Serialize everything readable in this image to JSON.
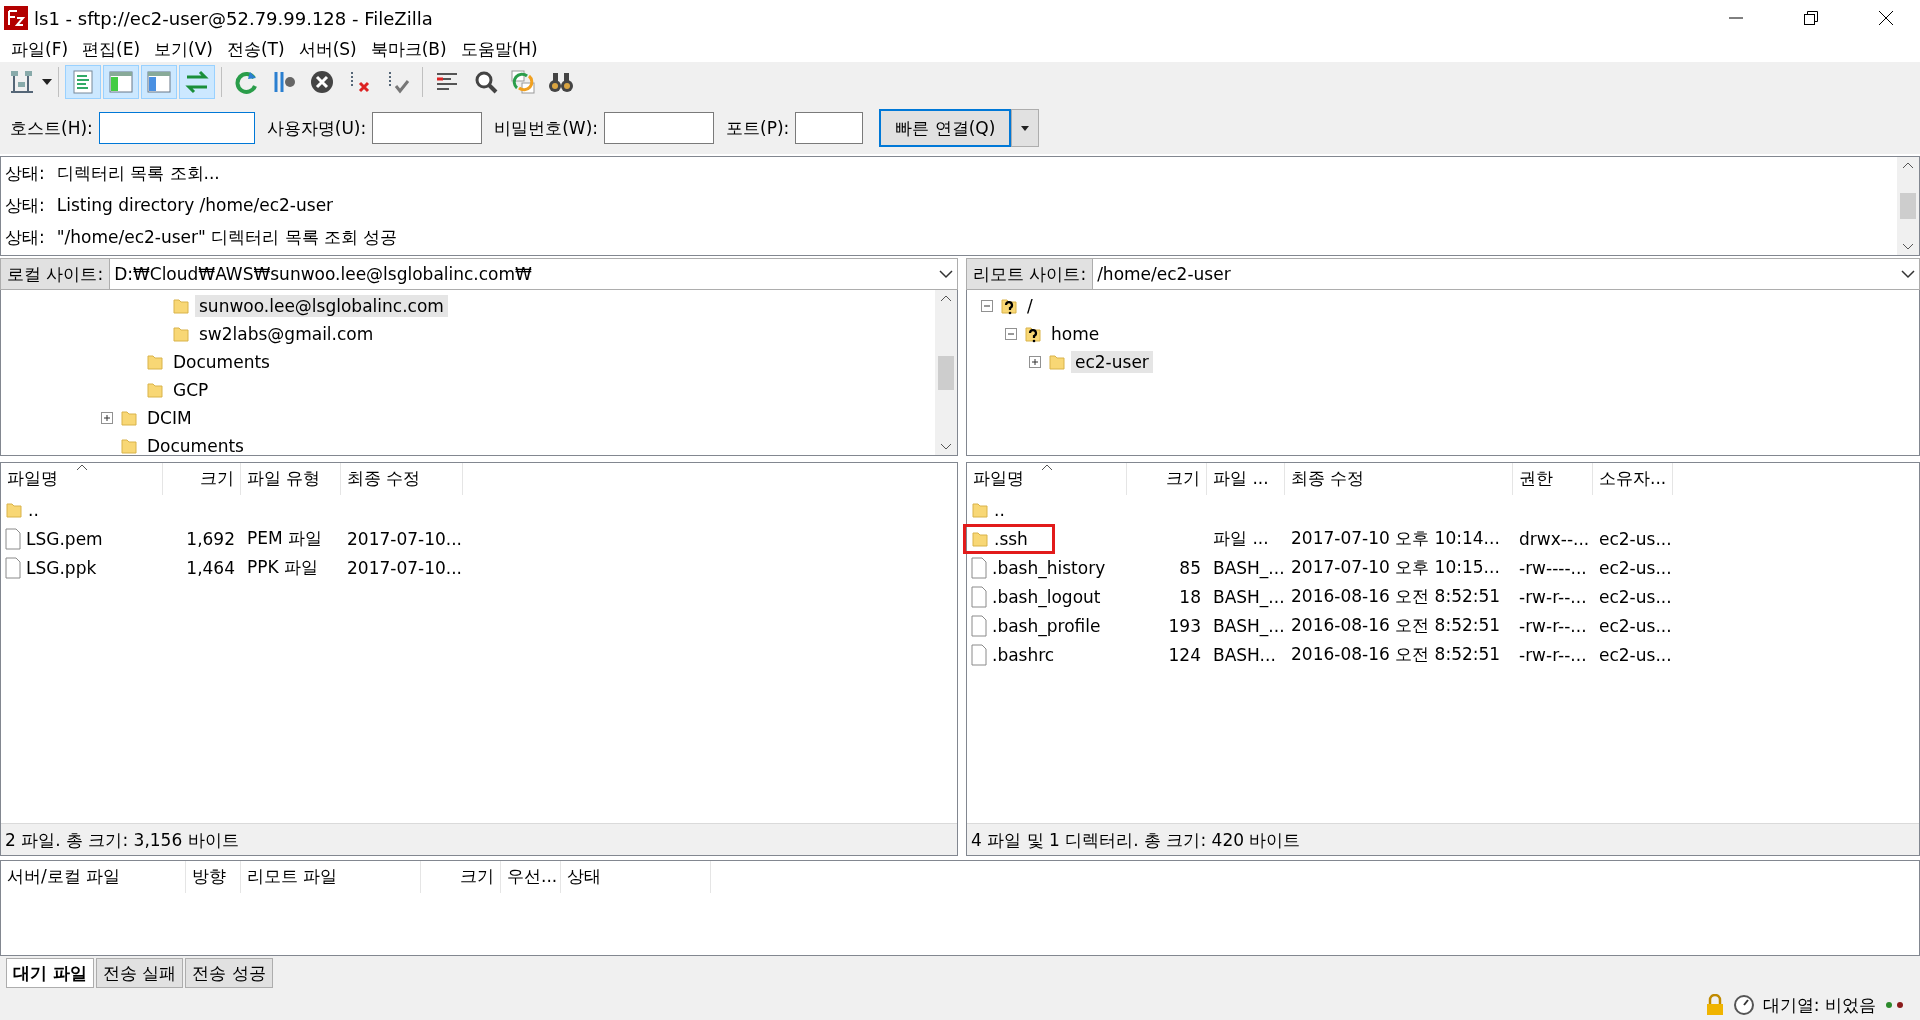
{
  "window": {
    "title": "ls1 - sftp://ec2-user@52.79.99.128 - FileZilla"
  },
  "menu": [
    "파일(F)",
    "편집(E)",
    "보기(V)",
    "전송(T)",
    "서버(S)",
    "북마크(B)",
    "도움말(H)"
  ],
  "toolbar": [
    {
      "kind": "sitemanager",
      "pressed": false
    },
    {
      "kind": "log",
      "pressed": true
    },
    {
      "kind": "localtree",
      "pressed": true
    },
    {
      "kind": "remotetree",
      "pressed": true
    },
    {
      "kind": "queue",
      "pressed": true
    },
    {
      "kind": "refresh",
      "pressed": false
    },
    {
      "kind": "process",
      "pressed": false
    },
    {
      "kind": "cancel",
      "pressed": false
    },
    {
      "kind": "disconnect",
      "pressed": false
    },
    {
      "kind": "reconnect",
      "pressed": false
    },
    {
      "kind": "compare",
      "pressed": false
    },
    {
      "kind": "filter",
      "pressed": false
    },
    {
      "kind": "sync",
      "pressed": false
    },
    {
      "kind": "find",
      "pressed": false
    }
  ],
  "quickconnect": {
    "fields": [
      {
        "label": "호스트(H):",
        "focused": true
      },
      {
        "label": "사용자명(U):",
        "focused": false
      },
      {
        "label": "비밀번호(W):",
        "focused": false
      },
      {
        "label": "포트(P):",
        "focused": false
      }
    ],
    "button": "빠른 연결(Q)"
  },
  "log": [
    {
      "label": "상태:",
      "text": "디렉터리 목록 조회..."
    },
    {
      "label": "상태:",
      "text": "Listing directory /home/ec2-user"
    },
    {
      "label": "상태:",
      "text": "\"/home/ec2-user\" 디렉터리 목록 조회 성공"
    }
  ],
  "local": {
    "site_label": "로컬 사이트:",
    "path": "D:₩Cloud₩AWS₩sunwoo.lee@lsglobalinc.com₩",
    "tree": [
      {
        "children": [
          {
            "children": [
              {
                "label": "sunwoo.lee@lsglobalinc.com",
                "kind": "folder",
                "selected": true
              },
              {
                "label": "sw2labs@gmail.com",
                "kind": "folder",
                "selected": false
              }
            ]
          },
          {
            "label": "Documents",
            "kind": "folder",
            "selected": false
          },
          {
            "label": "GCP",
            "kind": "folder",
            "selected": false
          }
        ]
      },
      {
        "label": "DCIM",
        "kind": "folder",
        "selected": false,
        "expanded": false
      },
      {
        "label": "Documents",
        "kind": "folder",
        "selected": false
      }
    ],
    "columns": [
      {
        "label": "파일명",
        "sorted": true
      },
      {
        "label": "크기",
        "sorted": false
      },
      {
        "label": "파일 유형",
        "sorted": false
      },
      {
        "label": "최종 수정",
        "sorted": false
      }
    ],
    "rows": [
      {
        "kind": "folder",
        "cells": [
          ".."
        ]
      },
      {
        "kind": "file",
        "cells": [
          "LSG.pem",
          "1,692",
          "PEM 파일",
          "2017-07-10..."
        ]
      },
      {
        "kind": "file",
        "cells": [
          "LSG.ppk",
          "1,464",
          "PPK 파일",
          "2017-07-10..."
        ]
      }
    ],
    "status": "2 파일. 총 크기: 3,156 바이트"
  },
  "remote": {
    "site_label": "리모트 사이트:",
    "path": "/home/ec2-user",
    "tree": [
      {
        "label": "/",
        "kind": "unknown",
        "selected": false,
        "expanded": true,
        "children": [
          {
            "label": "home",
            "kind": "unknown",
            "selected": false,
            "expanded": true,
            "children": [
              {
                "label": "ec2-user",
                "kind": "folder",
                "selected": true,
                "expanded": false
              }
            ]
          }
        ]
      }
    ],
    "columns": [
      {
        "label": "파일명",
        "sorted": true
      },
      {
        "label": "크기",
        "sorted": false
      },
      {
        "label": "파일 ...",
        "sorted": false
      },
      {
        "label": "최종 수정",
        "sorted": false
      },
      {
        "label": "권한",
        "sorted": false
      },
      {
        "label": "소유자...",
        "sorted": false
      }
    ],
    "rows": [
      {
        "kind": "folder",
        "cells": [
          ".."
        ],
        "highlighted": false
      },
      {
        "kind": "folder",
        "cells": [
          ".ssh",
          "",
          "파일 ...",
          "2017-07-10 오후 10:14...",
          "drwx--...",
          "ec2-us..."
        ],
        "highlighted": true
      },
      {
        "kind": "file",
        "cells": [
          ".bash_history",
          "85",
          "BASH_...",
          "2017-07-10 오후 10:15...",
          "-rw----...",
          "ec2-us..."
        ],
        "highlighted": false
      },
      {
        "kind": "file",
        "cells": [
          ".bash_logout",
          "18",
          "BASH_...",
          "2016-08-16 오전 8:52:51",
          "-rw-r--...",
          "ec2-us..."
        ],
        "highlighted": false
      },
      {
        "kind": "file",
        "cells": [
          ".bash_profile",
          "193",
          "BASH_...",
          "2016-08-16 오전 8:52:51",
          "-rw-r--...",
          "ec2-us..."
        ],
        "highlighted": false
      },
      {
        "kind": "file",
        "cells": [
          ".bashrc",
          "124",
          "BASH...",
          "2016-08-16 오전 8:52:51",
          "-rw-r--...",
          "ec2-us..."
        ],
        "highlighted": false
      }
    ],
    "status": "4 파일 및 1 디렉터리. 총 크기: 420 바이트"
  },
  "queue": {
    "columns": [
      "서버/로컬 파일",
      "방향",
      "리모트 파일",
      "크기",
      "우선...",
      "상태"
    ]
  },
  "tabs": [
    {
      "label": "대기 파일",
      "selected": true
    },
    {
      "label": "전송 실패",
      "selected": false
    },
    {
      "label": "전송 성공",
      "selected": false
    }
  ],
  "status_bar": {
    "queue": "대기열: 비었음"
  }
}
